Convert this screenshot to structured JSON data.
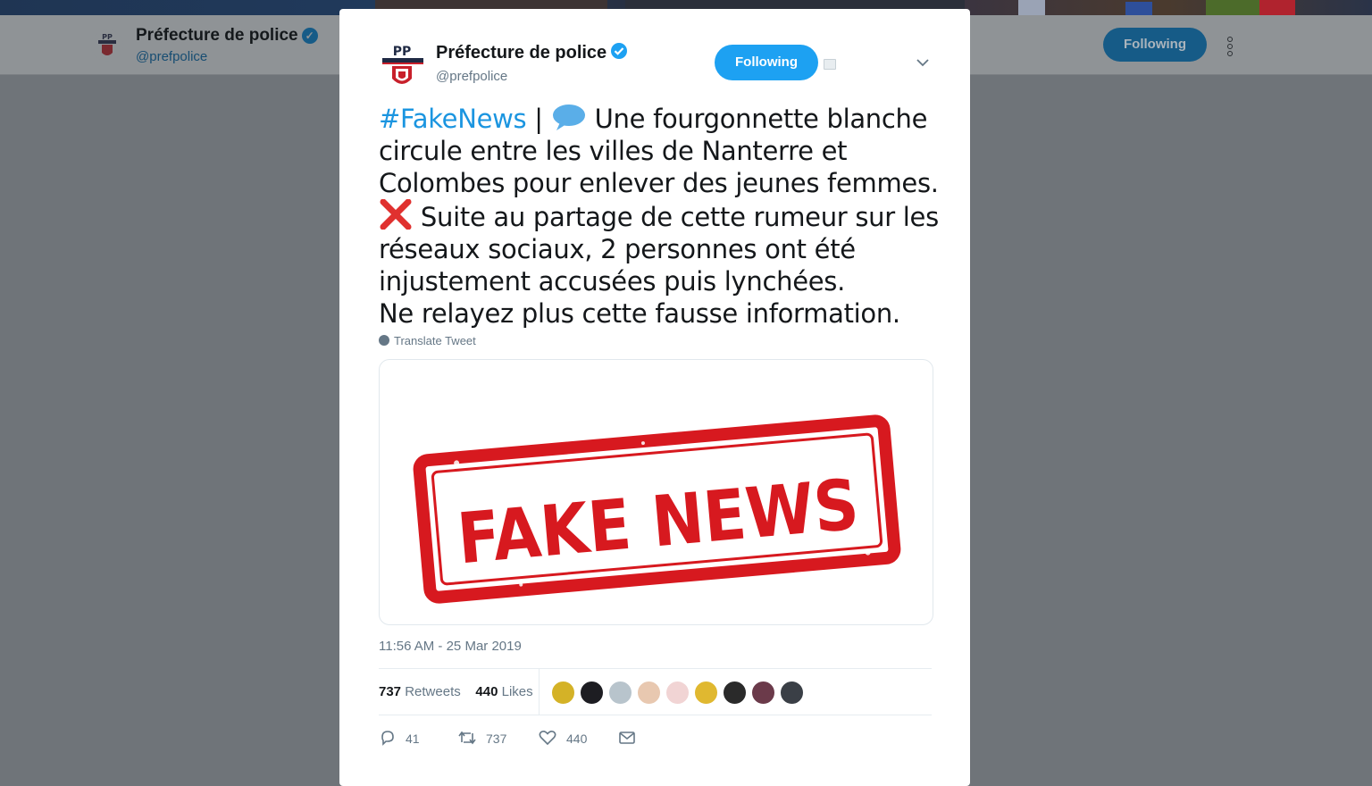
{
  "profile_header": {
    "name": "Préfecture de police",
    "handle": "@prefpolice",
    "follow_label": "Following"
  },
  "tweet": {
    "author_name": "Préfecture de police",
    "author_handle": "@prefpolice",
    "follow_label": "Following",
    "hashtag": "#FakeNews",
    "separator": "|",
    "line1": "Une fourgonnette blanche circule entre les villes de Nanterre et Colombes pour enlever des jeunes femmes.",
    "line2": "Suite au partage de cette rumeur sur les réseaux sociaux, 2 personnes ont été injustement accusées puis lynchées.",
    "line3": "Ne relayez plus cette fausse information.",
    "translate_label": "Translate Tweet",
    "image_text": "FAKE NEWS",
    "timestamp": "11:56 AM - 25 Mar 2019",
    "retweets_count": "737",
    "retweets_label": "Retweets",
    "likes_count": "440",
    "likes_label": "Likes",
    "actions": {
      "reply_count": "41",
      "retweet_count": "737",
      "like_count": "440"
    }
  },
  "colors": {
    "accent": "#1da1f2",
    "stamp_red": "#d7191f",
    "overlay": "#6f7479"
  },
  "icons": [
    "verified-badge-icon",
    "chevron-down-icon",
    "globe-icon",
    "reply-icon",
    "retweet-icon",
    "heart-icon",
    "mail-icon",
    "more-vertical-icon"
  ]
}
